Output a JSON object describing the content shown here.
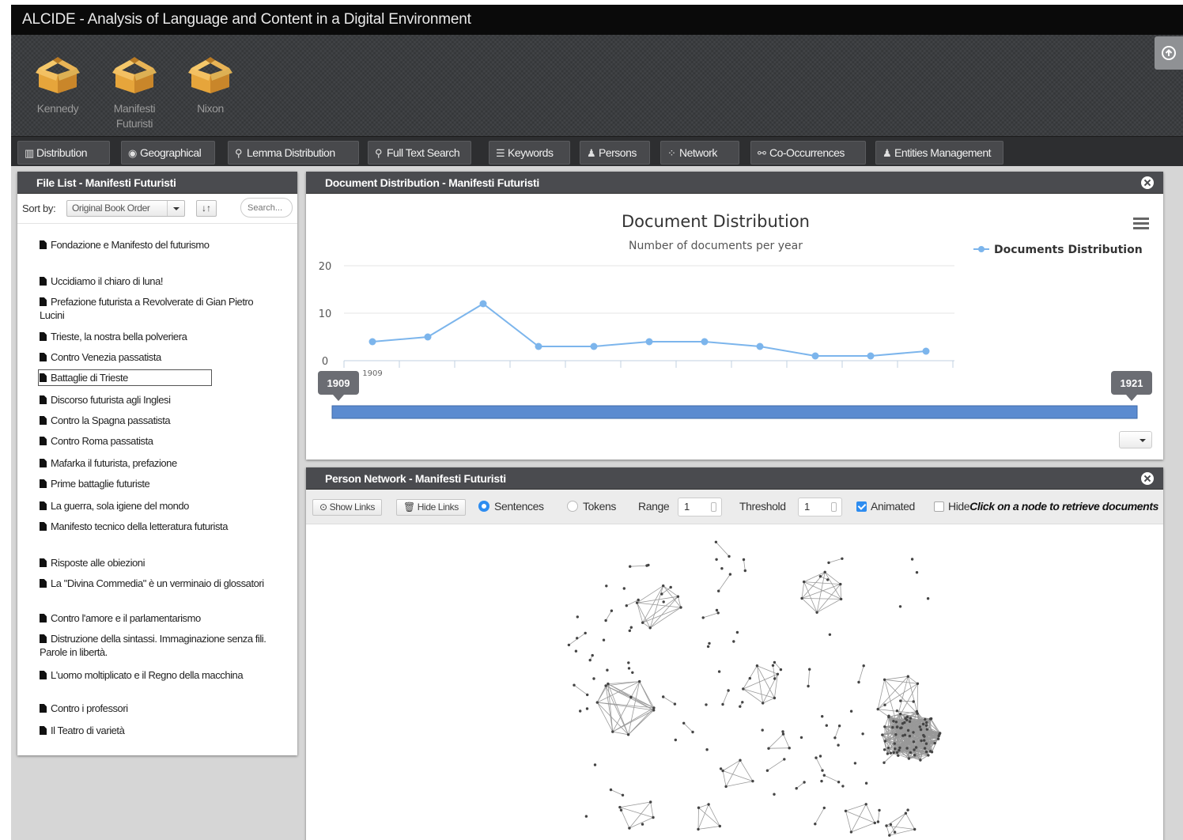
{
  "app": {
    "title": "ALCIDE - Analysis of Language and Content in a Digital Environment"
  },
  "corpora": [
    {
      "name": "Kennedy",
      "icon": "package-icon"
    },
    {
      "name": "Manifesti Futuristi",
      "icon": "package-icon",
      "active": true
    },
    {
      "name": "Nixon",
      "icon": "package-icon"
    }
  ],
  "nav": {
    "tabs": [
      {
        "label": "Distribution",
        "icon": "bar-chart-icon"
      },
      {
        "label": "Geographical",
        "icon": "globe-icon"
      },
      {
        "label": "Lemma Distribution",
        "icon": "search-icon"
      },
      {
        "label": "Full Text Search",
        "icon": "search-icon"
      },
      {
        "label": "Keywords",
        "icon": "list-icon"
      },
      {
        "label": "Persons",
        "icon": "user-icon"
      },
      {
        "label": "Network",
        "icon": "network-icon"
      },
      {
        "label": "Co-Occurrences",
        "icon": "link-icon"
      },
      {
        "label": "Entities Management",
        "icon": "user-icon"
      }
    ]
  },
  "filelist": {
    "title": "File List - Manifesti Futuristi",
    "sort_label": "Sort by:",
    "sort_value": "Original Book Order",
    "search_placeholder": "Search...",
    "items": [
      {
        "text": "Fondazione e Manifesto del futurismo"
      },
      {
        "text": "Uccidiamo il chiaro di luna!"
      },
      {
        "text": "Prefazione futurista a Revolverate di Gian Pietro Lucini"
      },
      {
        "text": "Trieste, la nostra bella polveriera"
      },
      {
        "text": "Contro Venezia passatista"
      },
      {
        "text": "Battaglie di Trieste",
        "selected": true
      },
      {
        "text": "Discorso futurista agli Inglesi"
      },
      {
        "text": "Contro la Spagna passatista"
      },
      {
        "text": "Contro Roma passatista"
      },
      {
        "text": "Mafarka il futurista, prefazione"
      },
      {
        "text": "Prime battaglie futuriste"
      },
      {
        "text": "La guerra, sola igiene del mondo"
      },
      {
        "text": "Manifesto tecnico della letteratura futurista"
      },
      {
        "text": "Risposte alle obiezioni"
      },
      {
        "text": "La \"Divina Commedia\" è un verminaio di glossatori"
      },
      {
        "text": "Contro l'amore e il parlamentarismo"
      },
      {
        "text": "Distruzione della sintassi. Immaginazione senza fili. Parole in libertà."
      },
      {
        "text": "L'uomo moltiplicato e il Regno della macchina"
      },
      {
        "text": "Contro i professori"
      },
      {
        "text": "Il Teatro di varietà"
      }
    ]
  },
  "distribution": {
    "panel_title": "Document Distribution - Manifesti Futuristi",
    "range_start": "1909",
    "range_end": "1921"
  },
  "network": {
    "panel_title": "Person Network - Manifesti Futuristi",
    "show_links": "Show Links",
    "hide_links": "Hide Links",
    "mode_sentences": "Sentences",
    "mode_tokens": "Tokens",
    "mode_selected": "Sentences",
    "range_label": "Range",
    "range_value": "1",
    "threshold_label": "Threshold",
    "threshold_value": "1",
    "animated_label": "Animated",
    "animated": true,
    "hide_label": "Hide",
    "hide_checked": false,
    "hint": "Click on a node to retrieve documents"
  },
  "chart_data": {
    "type": "line",
    "title": "Document Distribution",
    "subtitle": "Number of documents per year",
    "series": [
      {
        "name": "Documents Distribution",
        "color": "#7cb5ec",
        "values": [
          4,
          5,
          12,
          3,
          3,
          4,
          4,
          3,
          1,
          1,
          2
        ]
      }
    ],
    "x": [
      1909,
      1910,
      1911,
      1912,
      1913,
      1914,
      1915,
      1916,
      1917,
      1918,
      1919
    ],
    "x_tick_labels_shown": [
      "1909"
    ],
    "y_ticks": [
      0,
      10,
      20
    ],
    "ylim": [
      0,
      20
    ],
    "legend": "top-right",
    "grid": true
  }
}
